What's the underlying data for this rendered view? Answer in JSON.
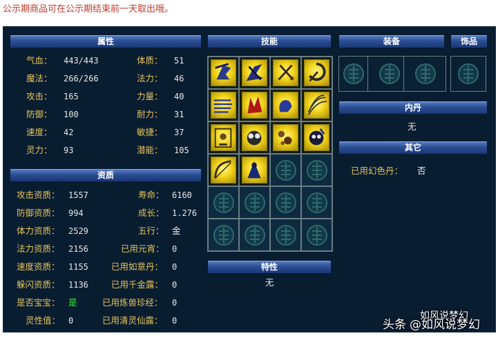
{
  "notice": "公示期商品可在公示期结束前一天取出哦。",
  "sections": {
    "attributes": "属性",
    "skills": "技能",
    "equipment": "装备",
    "accessory": "饰品",
    "neidan": "内丹",
    "other": "其它",
    "aptitude": "资质",
    "special": "特性"
  },
  "attributes": {
    "left": [
      {
        "label": "气血：",
        "value": "443/443"
      },
      {
        "label": "魔法：",
        "value": "266/266"
      },
      {
        "label": "攻击：",
        "value": "165"
      },
      {
        "label": "防御：",
        "value": "100"
      },
      {
        "label": "速度：",
        "value": "42"
      },
      {
        "label": "灵力：",
        "value": "93"
      }
    ],
    "right": [
      {
        "label": "体质：",
        "value": "51"
      },
      {
        "label": "法力：",
        "value": "46"
      },
      {
        "label": "力量：",
        "value": "40"
      },
      {
        "label": "耐力：",
        "value": "31"
      },
      {
        "label": "敏捷：",
        "value": "37"
      },
      {
        "label": "潜能：",
        "value": "105"
      }
    ]
  },
  "aptitude": {
    "left": [
      {
        "label": "攻击资质：",
        "value": "1557"
      },
      {
        "label": "防御资质：",
        "value": "994"
      },
      {
        "label": "体力资质：",
        "value": "2529"
      },
      {
        "label": "法力资质：",
        "value": "2156"
      },
      {
        "label": "速度资质：",
        "value": "1155"
      },
      {
        "label": "躲闪资质：",
        "value": "1136"
      },
      {
        "label": "是否宝宝：",
        "value": "是"
      },
      {
        "label": "灵性值：",
        "value": "0"
      }
    ],
    "right": [
      {
        "label": "寿命：",
        "value": "6160"
      },
      {
        "label": "成长：",
        "value": "1.276"
      },
      {
        "label": "五行：",
        "value": "金"
      },
      {
        "label": "已用元宵：",
        "value": "0"
      },
      {
        "label": "已用如意丹：",
        "value": "0"
      },
      {
        "label": "已用千金露：",
        "value": "0"
      },
      {
        "label": "已用炼兽珍经：",
        "value": "0"
      },
      {
        "label": "已用清灵仙露：",
        "value": "0"
      }
    ]
  },
  "neidan_value": "无",
  "special_value": "无",
  "other": {
    "label": "已用幻色丹：",
    "value": "否"
  },
  "skills": [
    "skill-icon-1",
    "skill-icon-2",
    "skill-icon-3",
    "skill-icon-4",
    "skill-icon-5",
    "skill-icon-6",
    "skill-icon-7",
    "skill-icon-8",
    "skill-icon-9",
    "skill-icon-10",
    "skill-icon-11",
    "skill-icon-12",
    "skill-icon-13",
    "skill-icon-14"
  ],
  "colors": {
    "panel": "#091d31",
    "label": "#e6c35a",
    "value": "#e8e8e8",
    "yes": "#3be83b",
    "notice": "#c0392b"
  },
  "watermark": {
    "main": "头条",
    "sub": "@如风说梦幻",
    "tag": "如风说梦幻"
  }
}
